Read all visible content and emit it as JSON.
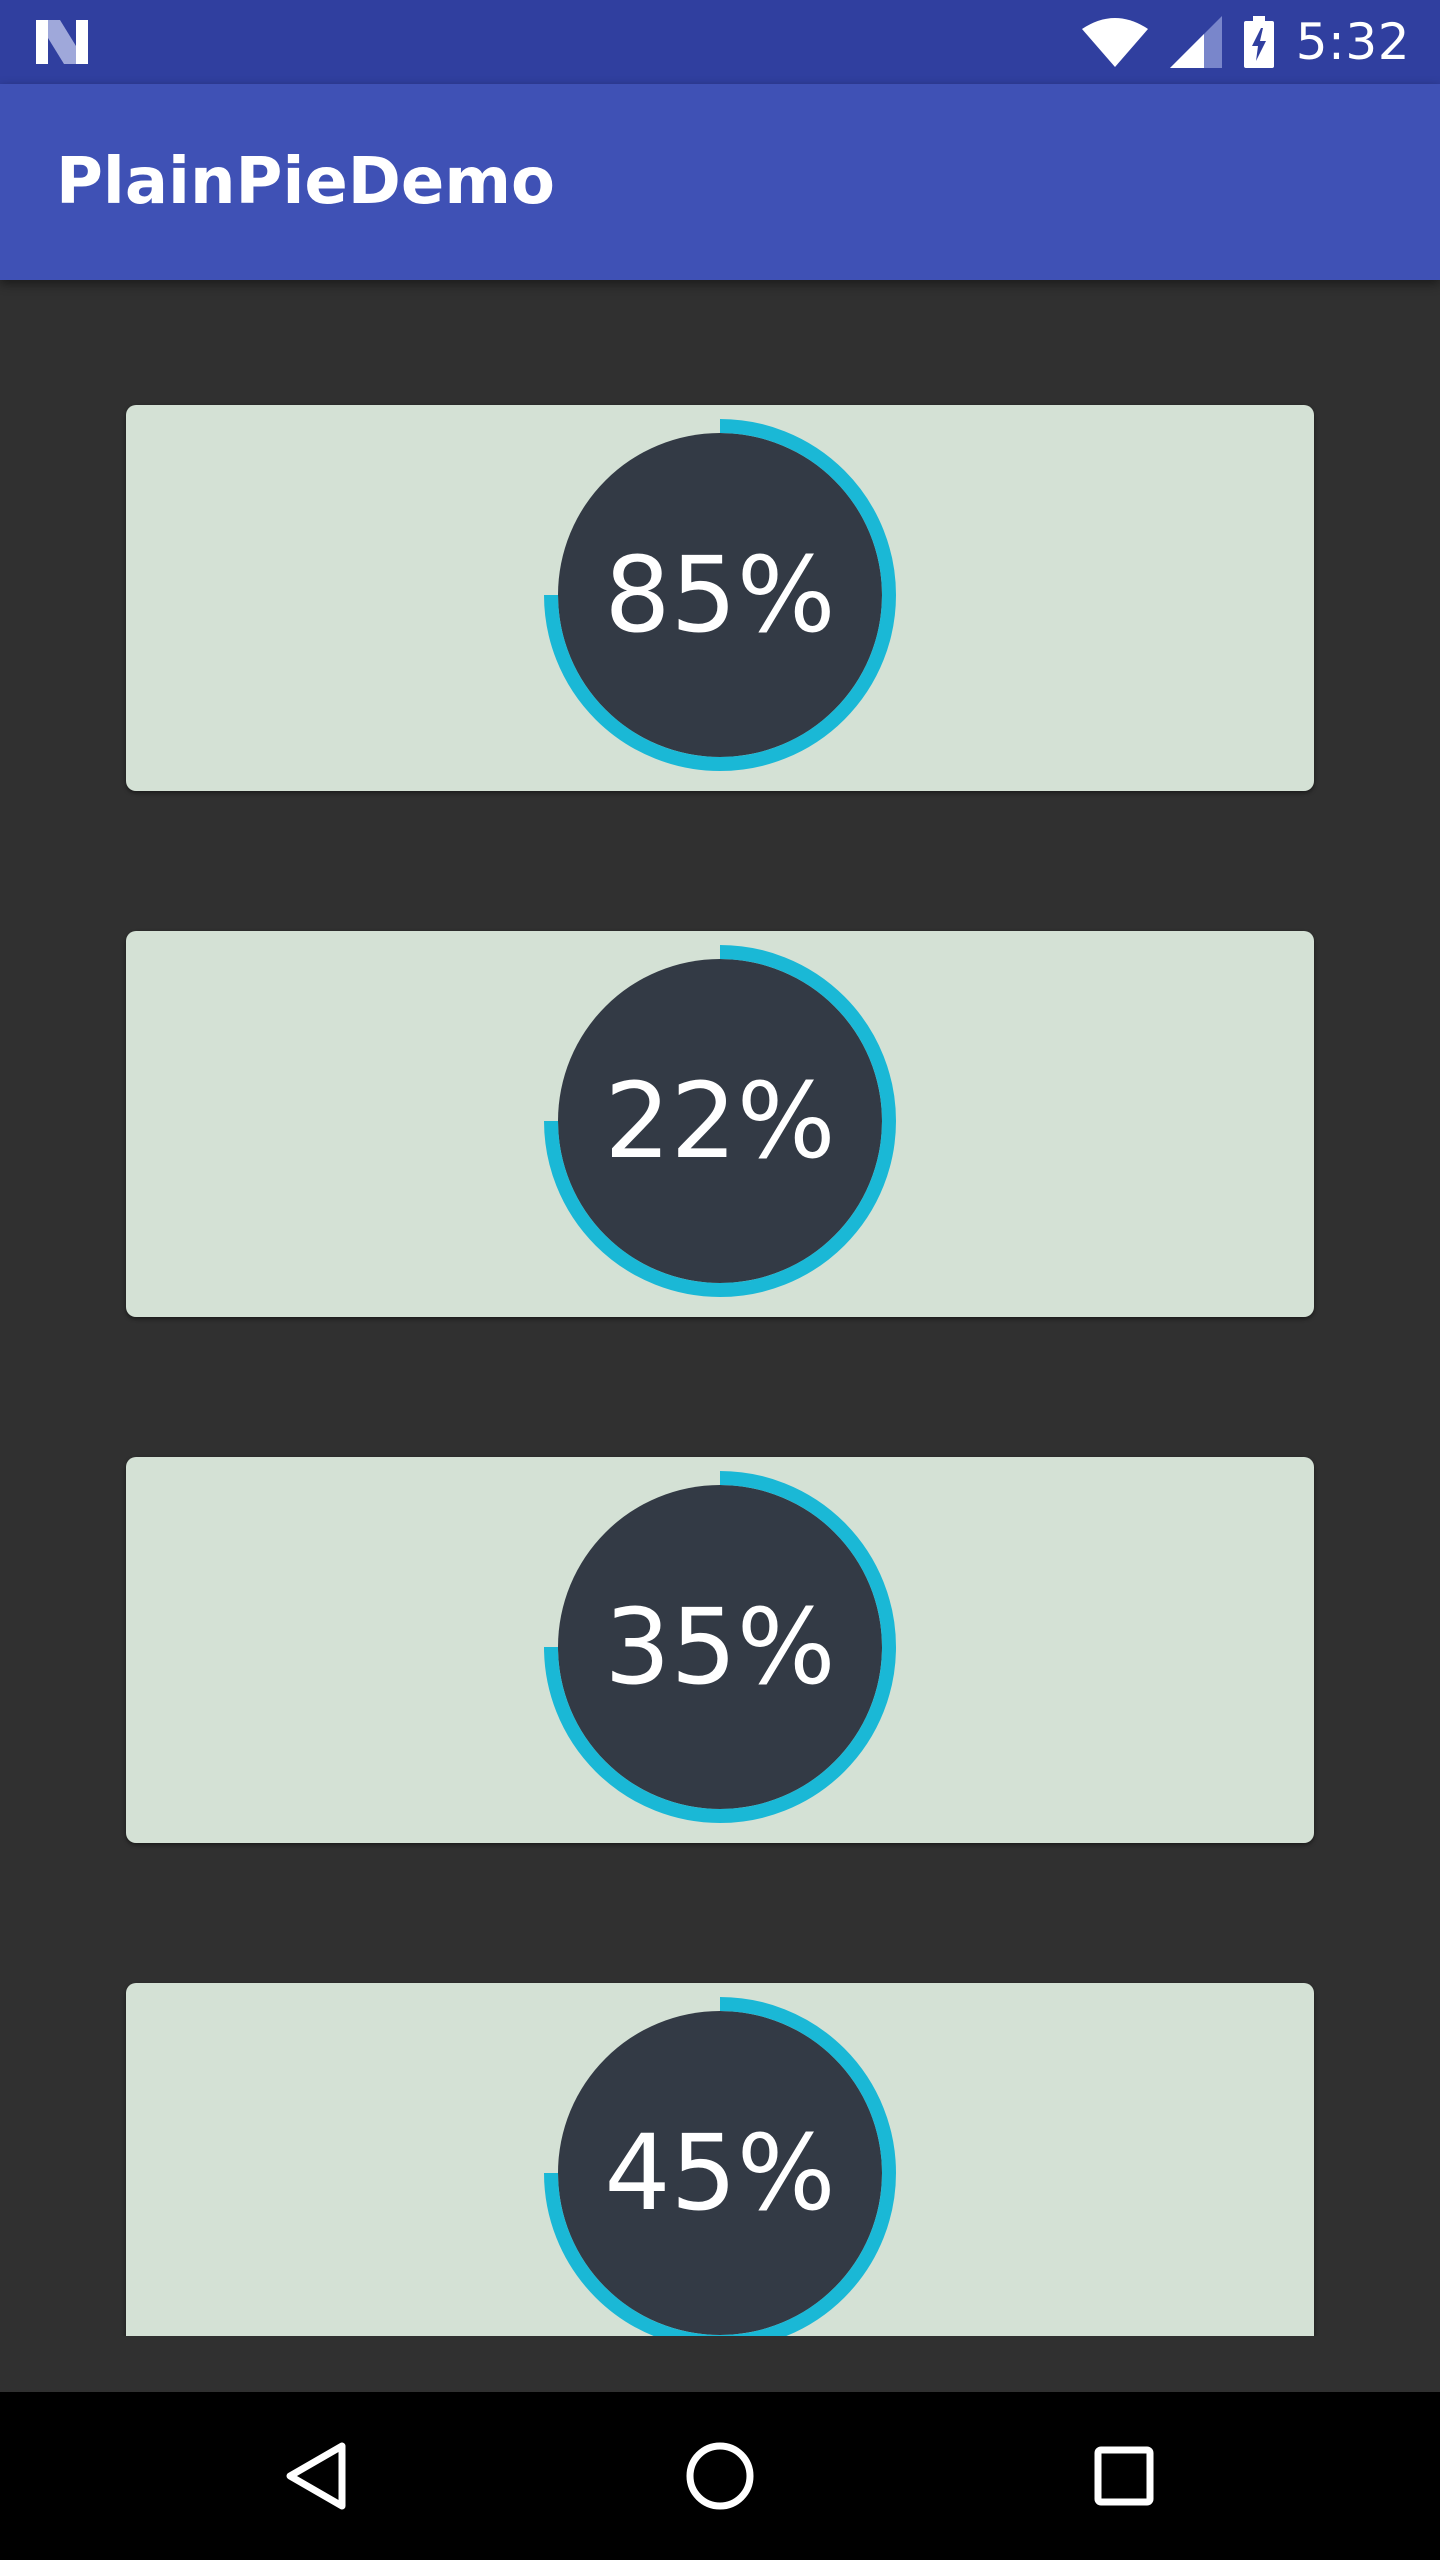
{
  "status_bar": {
    "time": "5:32",
    "icons": [
      "android-n-icon",
      "wifi-icon",
      "signal-icon",
      "battery-charging-icon"
    ],
    "color": "#303F9F"
  },
  "app_bar": {
    "title": "PlainPieDemo",
    "color": "#3F51B5"
  },
  "pies": [
    {
      "label": "85%",
      "value": 85
    },
    {
      "label": "22%",
      "value": 22
    },
    {
      "label": "35%",
      "value": 35
    },
    {
      "label": "45%",
      "value": 45
    }
  ],
  "colors": {
    "background": "#303030",
    "card": "#D4E1D5",
    "pie_inner": "#333A45",
    "pie_ring": "#1AB8D6",
    "text": "#FFFFFF"
  },
  "nav_bar": {
    "buttons": [
      "back-icon",
      "home-icon",
      "recents-icon"
    ]
  }
}
